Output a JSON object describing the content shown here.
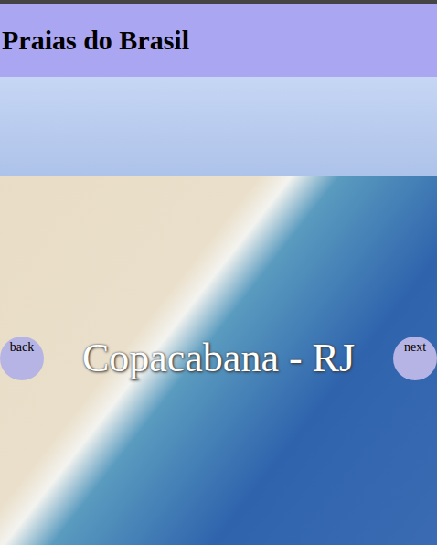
{
  "header": {
    "title": "Praias do Brasil"
  },
  "slider": {
    "caption": "Copacabana - RJ",
    "buttons": [
      {
        "label": "back"
      },
      {
        "label": "next"
      }
    ]
  }
}
